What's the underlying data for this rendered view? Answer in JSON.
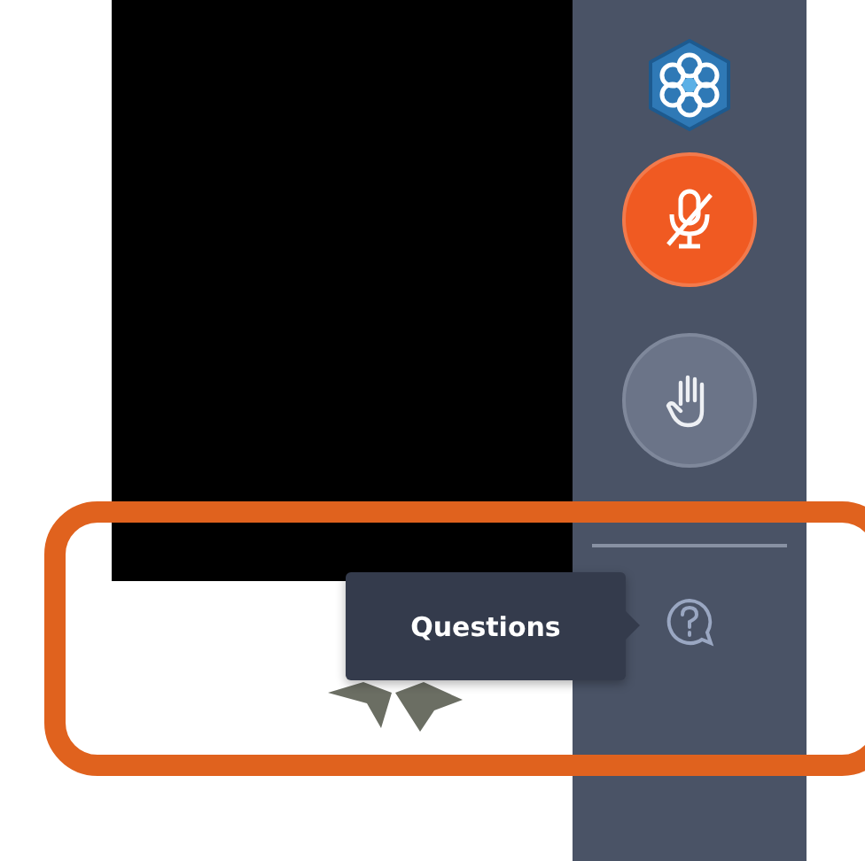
{
  "sidebar": {
    "buttons": [
      {
        "kind": "logo"
      },
      {
        "kind": "mic",
        "muted": true
      },
      {
        "kind": "raise_hand"
      },
      {
        "kind": "divider"
      },
      {
        "kind": "questions"
      }
    ]
  },
  "tooltip": {
    "text": "Questions"
  }
}
